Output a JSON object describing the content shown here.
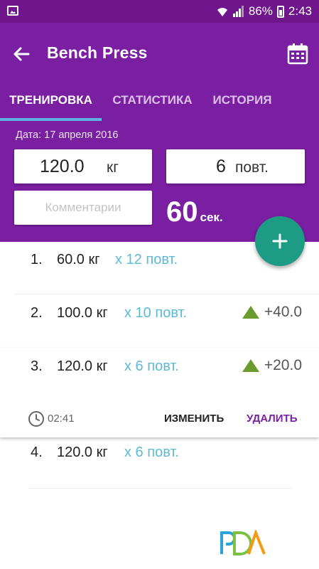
{
  "status_bar": {
    "battery": "86%",
    "time": "2:43"
  },
  "app_bar": {
    "title": "Bench Press"
  },
  "tabs": [
    {
      "label": "ТРЕНИРОВКА",
      "active": true
    },
    {
      "label": "СТАТИСТИКА",
      "active": false
    },
    {
      "label": "ИСТОРИЯ",
      "active": false
    }
  ],
  "form": {
    "date": "Дата: 17 апреля 2016",
    "weight_value": "120.0",
    "weight_unit": "кг",
    "reps_value": "6",
    "reps_unit": "повт.",
    "comment_placeholder": "Комментарии",
    "rest_value": "60",
    "rest_unit": "сек."
  },
  "sets": [
    {
      "number": "1.",
      "weight": "60.0 кг",
      "reps": "x 12 повт.",
      "delta": ""
    },
    {
      "number": "2.",
      "weight": "100.0 кг",
      "reps": "x 10 повт.",
      "delta": "+40.0"
    },
    {
      "number": "3.",
      "weight": "120.0 кг",
      "reps": "x 6 повт.",
      "delta": "+20.0",
      "time": "02:41",
      "edit_label": "ИЗМЕНИТЬ",
      "delete_label": "УДАЛИТЬ"
    },
    {
      "number": "4.",
      "weight": "120.0 кг",
      "reps": "x 6 повт.",
      "delta": ""
    }
  ],
  "colors": {
    "primary": "#7b1fa2",
    "status_bar": "#6f168c",
    "accent_fab": "#1e9b84",
    "reps_text": "#5bbad6",
    "tab_indicator": "#5fb4e2",
    "delta_up": "#6b9b2e"
  },
  "icons": [
    "gallery-icon",
    "wifi-icon",
    "signal-icon",
    "battery-icon",
    "back-arrow-icon",
    "calendar-icon",
    "plus-icon",
    "triangle-up-icon",
    "clock-icon"
  ]
}
